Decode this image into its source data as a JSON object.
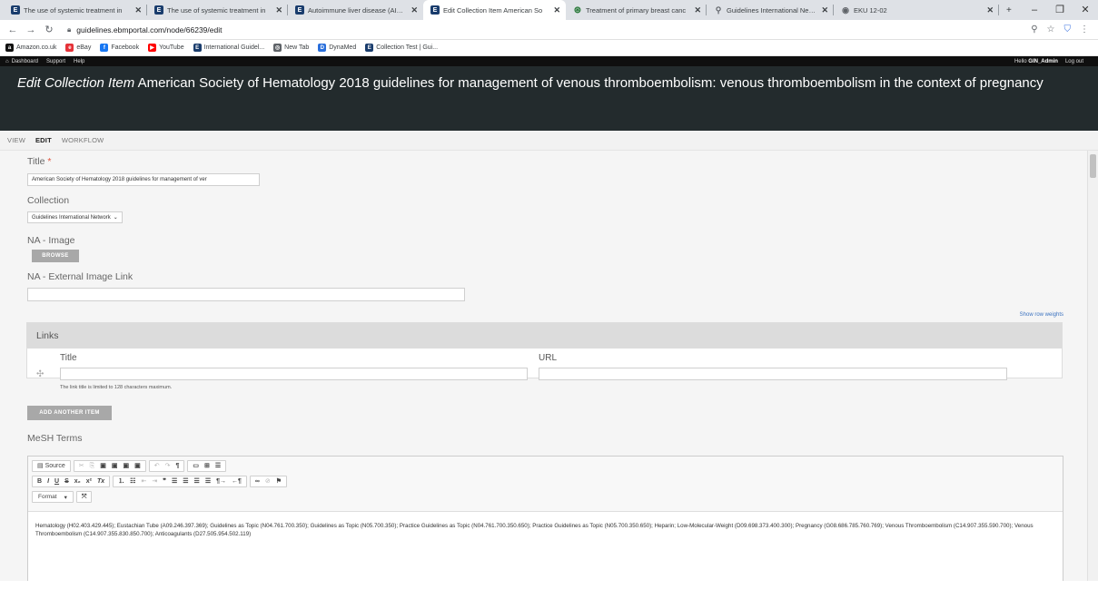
{
  "browser": {
    "tabs": [
      {
        "label": "The use of systemic treatment in",
        "icon": "e-favicon"
      },
      {
        "label": "The use of systemic treatment in",
        "icon": "e-favicon"
      },
      {
        "label": "Autoimmune liver disease (AILD)",
        "icon": "e-favicon"
      },
      {
        "label": "Edit Collection Item American So",
        "icon": "e-favicon"
      },
      {
        "label": "Treatment of primary breast canc",
        "icon": "green-favicon"
      },
      {
        "label": "Guidelines International Network",
        "icon": "gin-favicon"
      },
      {
        "label": "EKU 12-02",
        "icon": "globe-favicon"
      }
    ],
    "new_tab": "+",
    "url": "guidelines.ebmportal.com/node/66239/edit",
    "bookmarks": [
      {
        "label": "Amazon.co.uk",
        "color": "#111111",
        "glyph": "a"
      },
      {
        "label": "eBay",
        "color": "#e53238",
        "glyph": "e"
      },
      {
        "label": "Facebook",
        "color": "#1877f2",
        "glyph": "f"
      },
      {
        "label": "YouTube",
        "color": "#ff0000",
        "glyph": "▶"
      },
      {
        "label": "International Guidel...",
        "color": "#1a3d6d",
        "glyph": "E"
      },
      {
        "label": "New Tab",
        "color": "#5f6368",
        "glyph": "◎"
      },
      {
        "label": "DynaMed",
        "color": "#2a6fdb",
        "glyph": "D"
      },
      {
        "label": "Collection Test | Gui...",
        "color": "#1a3d6d",
        "glyph": "E"
      }
    ]
  },
  "admin": {
    "dashboard": "Dashboard",
    "support": "Support",
    "help": "Help",
    "hello_prefix": "Hello ",
    "username": "GIN_Admin",
    "logout": "Log out"
  },
  "header": {
    "prefix": "Edit Collection Item",
    "title": " American Society of Hematology 2018 guidelines for management of venous thromboembolism: venous thromboembolism in the context of pregnancy"
  },
  "local_tasks": [
    "VIEW",
    "EDIT",
    "WORKFLOW"
  ],
  "form": {
    "title_label": "Title",
    "required_mark": "*",
    "title_value": "American Society of Hematology 2018 guidelines for management of ver",
    "collection_label": "Collection",
    "collection_value": "Guidelines International Network",
    "image_label": "NA - Image",
    "browse_label": "BROWSE",
    "ext_image_label": "NA - External Image Link",
    "ext_image_value": "",
    "show_row_weights": "Show row weights",
    "links_label": "Links",
    "links_title_col": "Title",
    "links_url_col": "URL",
    "links_help": "The link title is limited to 128 characters maximum.",
    "add_another_item": "ADD ANOTHER ITEM",
    "mesh_label": "MeSH Terms",
    "editor_source": "Source",
    "editor_format": "Format",
    "mesh_text": "Hematology (H02.403.429.445); Eustachian Tube (A09.246.397.369); Guidelines as Topic (N04.761.700.350); Guidelines as Topic (N05.700.350); Practice Guidelines as Topic (N04.761.700.350.650); Practice Guidelines as Topic (N05.700.350.650); Heparin; Low-Molecular-Weight (D09.698.373.400.300); Pregnancy (G08.686.785.760.769); Venous Thromboembolism (C14.907.355.590.700); Venous Thromboembolism (C14.907.355.830.850.700); Anticoagulants (D27.505.954.502.119)"
  }
}
